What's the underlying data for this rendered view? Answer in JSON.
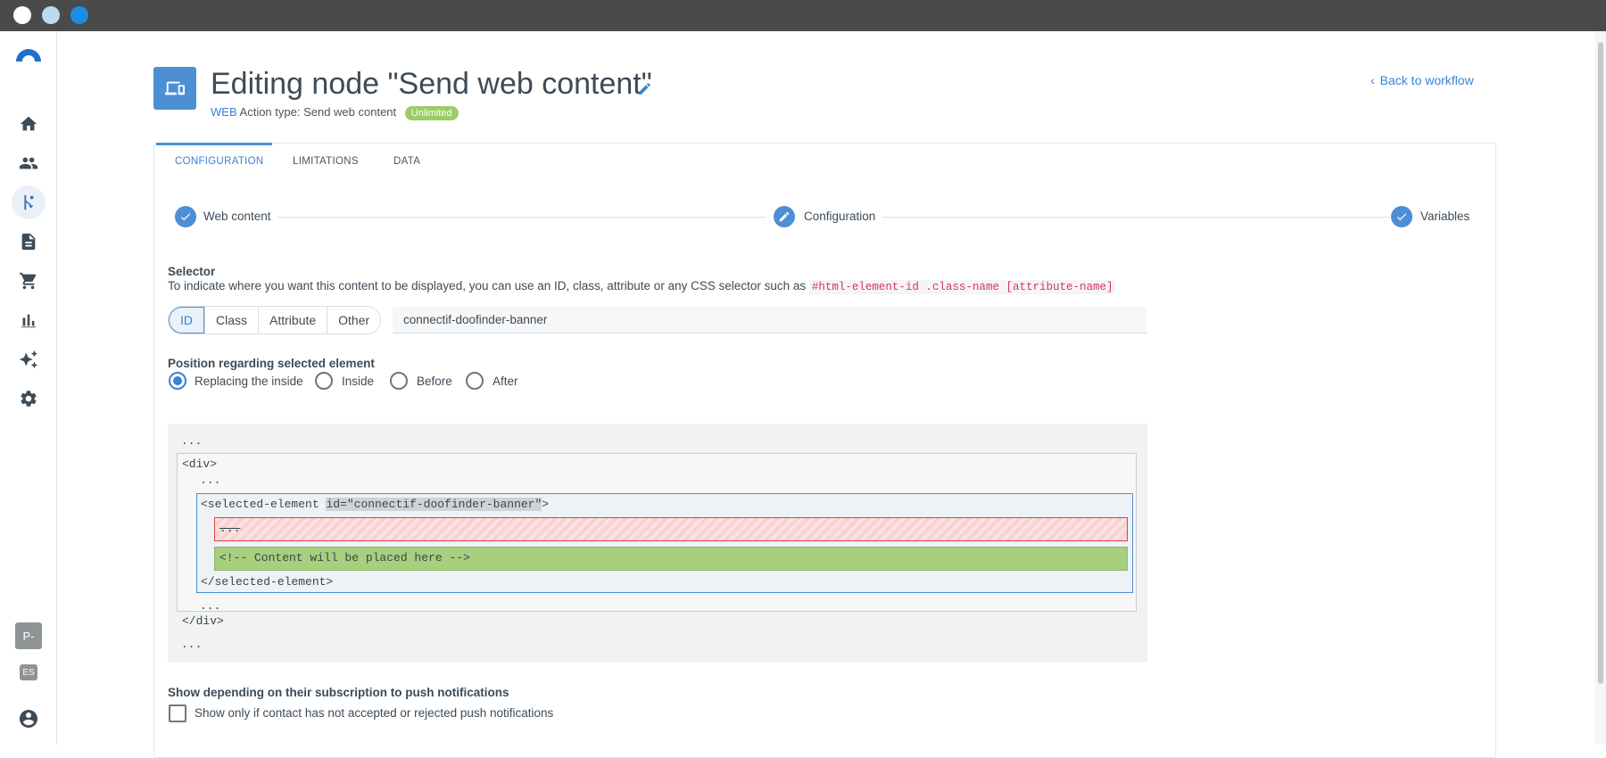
{
  "header": {
    "title": "Editing node \"Send web content\"",
    "channel": "WEB",
    "action_type": "Action type: Send web content",
    "badge": "Unlimited",
    "back_link": "Back to workflow"
  },
  "tabs": [
    {
      "label": "CONFIGURATION",
      "active": true
    },
    {
      "label": "LIMITATIONS",
      "active": false
    },
    {
      "label": "DATA",
      "active": false
    }
  ],
  "steps": [
    {
      "label": "Web content",
      "state": "done"
    },
    {
      "label": "Configuration",
      "state": "editing"
    },
    {
      "label": "Variables",
      "state": "done"
    }
  ],
  "selector": {
    "title": "Selector",
    "description": "To indicate where you want this content to be displayed, you can use an ID, class, attribute or any CSS selector such as",
    "example": "#html-element-id .class-name [attribute-name]",
    "types": [
      "ID",
      "Class",
      "Attribute",
      "Other"
    ],
    "selected_type": "ID",
    "value": "connectif-doofinder-banner"
  },
  "position": {
    "title": "Position regarding selected element",
    "options": [
      "Replacing the inside",
      "Inside",
      "Before",
      "After"
    ],
    "selected": "Replacing the inside"
  },
  "preview": {
    "ellipsis": "...",
    "div_open": "<div>",
    "div_close": "</div>",
    "element_open": "<selected-element ",
    "element_id": "id=\"connectif-doofinder-banner\"",
    "element_open_end": ">",
    "replaced": "...",
    "placeholder": "<!-- Content will be placed here -->",
    "element_close": "</selected-element>"
  },
  "push": {
    "title": "Show depending on their subscription to push notifications",
    "checkbox_label": "Show only if contact has not accepted or rejected push notifications",
    "checked": false
  },
  "sidebar": {
    "items": [
      "home-icon",
      "contacts-icon",
      "workflows-icon",
      "content-icon",
      "store-icon",
      "reports-icon",
      "ai-icon",
      "settings-icon"
    ],
    "active": "workflows-icon",
    "account_badge": "P-",
    "language_badge": "ES"
  },
  "colors": {
    "accent": "#4d8fd4",
    "success_badge": "#9ccc65",
    "replace_border": "#e0403a",
    "content_fill": "#a6cf7e"
  }
}
